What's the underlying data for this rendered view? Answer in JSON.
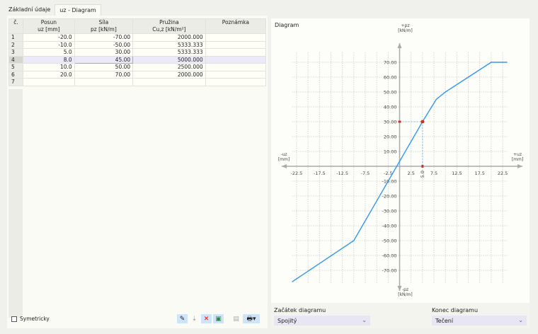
{
  "tabs": [
    "Základní údaje",
    "uz - Diagram"
  ],
  "table": {
    "headers": [
      [
        "č.",
        ""
      ],
      [
        "Posun",
        "uz [mm]"
      ],
      [
        "Síla",
        "pz [kN/m]"
      ],
      [
        "Pružina",
        "Cu,z [kN/m²]"
      ],
      [
        "Poznámka",
        ""
      ]
    ],
    "rows": [
      [
        "1",
        "-20.0",
        "-70.00",
        "2000.000",
        ""
      ],
      [
        "2",
        "-10.0",
        "-50.00",
        "5333.333",
        ""
      ],
      [
        "3",
        "5.0",
        "30.00",
        "5333.333",
        ""
      ],
      [
        "4",
        "8.0",
        "45.00",
        "5000.000",
        ""
      ],
      [
        "5",
        "10.0",
        "50.00",
        "2500.000",
        ""
      ],
      [
        "6",
        "20.0",
        "70.00",
        "2000.000",
        ""
      ],
      [
        "7",
        "",
        "",
        "",
        ""
      ]
    ]
  },
  "symmetric_label": "Symetricky",
  "diagram_title": "Diagram",
  "start_label": "Začátek diagramu",
  "start_value": "Spojitý",
  "end_label": "Konec diagramu",
  "end_value": "Tečení",
  "chart_data": {
    "type": "line",
    "xlabel_pos": "+uz [mm]",
    "xlabel_neg": "-uz [mm]",
    "ylabel_pos": "+pz [kN/m]",
    "ylabel_neg": "-pz [kN/m]",
    "x": [
      -23.4,
      -10,
      5,
      8,
      10,
      20,
      23.4
    ],
    "y": [
      -77.6,
      -50,
      30,
      45,
      50,
      70,
      70
    ],
    "xticks": [
      -22.5,
      -17.5,
      -12.5,
      -7.5,
      -2.5,
      2.5,
      7.5,
      12.5,
      17.5,
      22.5
    ],
    "yticks": [
      70,
      60,
      50,
      40,
      30,
      20,
      10,
      -10,
      -20,
      -30,
      -40,
      -50,
      -60,
      -70
    ],
    "marked_point": {
      "x": 5.0,
      "y": 30.0,
      "xlabel": "5.0",
      "ylabel": "30.00"
    },
    "line_color": "#3399ee",
    "marker_color": "#cc3322"
  }
}
